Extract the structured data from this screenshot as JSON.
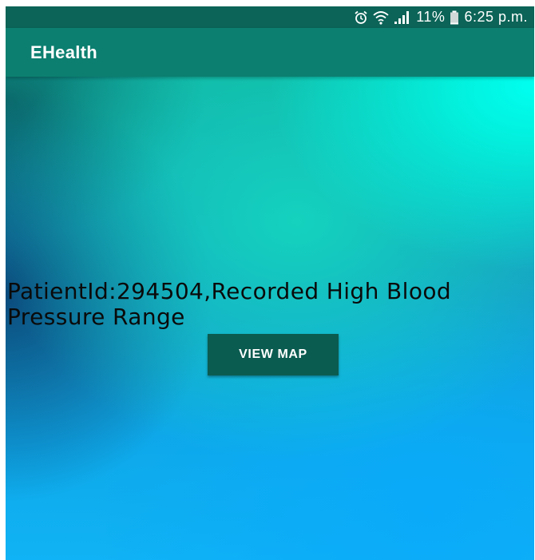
{
  "status_bar": {
    "icons": [
      "alarm-icon",
      "wifi-icon",
      "signal-icon",
      "battery-icon"
    ],
    "battery_percent": "11%",
    "time": "6:25 p.m."
  },
  "app_bar": {
    "title": "EHealth",
    "color": "#0c7f70"
  },
  "main": {
    "message": "PatientId:294504,Recorded High Blood Pressure Range",
    "view_map_label": "VIEW MAP"
  },
  "colors": {
    "status_bar": "#0b6457",
    "button": "#0b5c50",
    "accent_cyan": "#00fff0",
    "accent_blue": "#10b3f5"
  }
}
